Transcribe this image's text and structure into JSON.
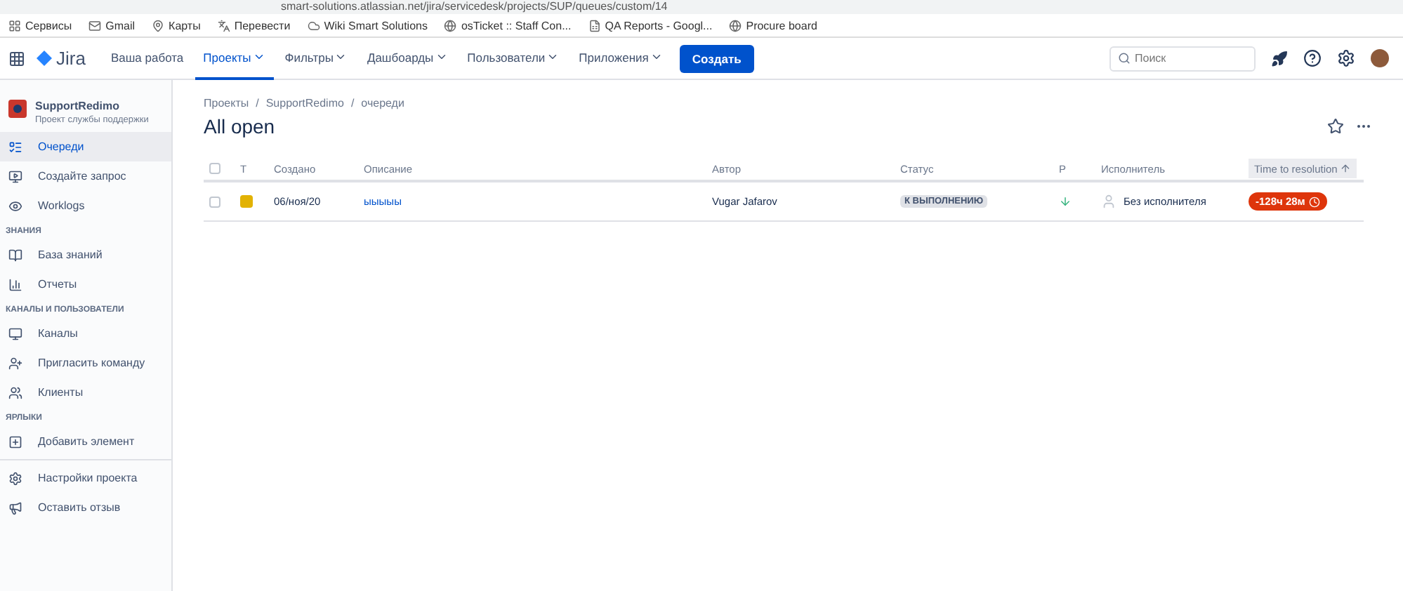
{
  "browser": {
    "address": "smart-solutions.atlassian.net/jira/servicedesk/projects/SUP/queues/custom/14",
    "bookmarks": [
      {
        "label": "Сервисы"
      },
      {
        "label": "Gmail"
      },
      {
        "label": "Карты"
      },
      {
        "label": "Перевести"
      },
      {
        "label": "Wiki Smart Solutions"
      },
      {
        "label": "osTicket :: Staff Con..."
      },
      {
        "label": "QA Reports - Googl..."
      },
      {
        "label": "Procure board"
      }
    ]
  },
  "nav": {
    "product": "Jira",
    "items": [
      {
        "label": "Ваша работа",
        "selected": false,
        "dropdown": false
      },
      {
        "label": "Проекты",
        "selected": true,
        "dropdown": true
      },
      {
        "label": "Фильтры",
        "selected": false,
        "dropdown": true
      },
      {
        "label": "Дашбоарды",
        "selected": false,
        "dropdown": true
      },
      {
        "label": "Пользователи",
        "selected": false,
        "dropdown": true
      },
      {
        "label": "Приложения",
        "selected": false,
        "dropdown": true
      }
    ],
    "create_button": "Создать",
    "search": {
      "placeholder": "Поиск"
    }
  },
  "sidebar": {
    "project": {
      "name": "SupportRedimo",
      "subtitle": "Проект службы поддержки"
    },
    "sections": [
      {
        "items": [
          {
            "label": "Очереди",
            "selected": true
          },
          {
            "label": "Создайте запрос",
            "selected": false
          },
          {
            "label": "Worklogs",
            "selected": false
          }
        ]
      },
      {
        "heading": "ЗНАНИЯ",
        "items": [
          {
            "label": "База знаний",
            "selected": false
          },
          {
            "label": "Отчеты",
            "selected": false
          }
        ]
      },
      {
        "heading": "КАНАЛЫ И ПОЛЬЗОВАТЕЛИ",
        "items": [
          {
            "label": "Каналы",
            "selected": false
          },
          {
            "label": "Пригласить команду",
            "selected": false
          },
          {
            "label": "Клиенты",
            "selected": false
          }
        ]
      },
      {
        "heading": "ЯРЛЫКИ",
        "items": [
          {
            "label": "Добавить элемент",
            "selected": false
          }
        ]
      },
      {
        "divider": true,
        "items": [
          {
            "label": "Настройки проекта",
            "selected": false
          },
          {
            "label": "Оставить отзыв",
            "selected": false
          }
        ]
      }
    ]
  },
  "main": {
    "breadcrumbs": [
      "Проекты",
      "SupportRedimo",
      "очереди"
    ],
    "breadcrumb_separator": "/",
    "title": "All open",
    "table": {
      "select_all_checked": false,
      "columns": [
        {
          "label": "T",
          "sorted": false
        },
        {
          "label": "Создано",
          "sorted": false
        },
        {
          "label": "Описание",
          "sorted": false
        },
        {
          "label": "Автор",
          "sorted": false
        },
        {
          "label": "Статус",
          "sorted": false
        },
        {
          "label": "P",
          "sorted": false
        },
        {
          "label": "Исполнитель",
          "sorted": false
        },
        {
          "label": "Time to resolution",
          "sorted": true
        }
      ],
      "rows": [
        {
          "checked": false,
          "created": "06/ноя/20",
          "description": "ыыыыы",
          "author": "Vugar Jafarov",
          "status": "К ВЫПОЛНЕНИЮ",
          "assignee": "Без исполнителя",
          "time_to_resolution": "-128ч 28м"
        }
      ]
    }
  }
}
